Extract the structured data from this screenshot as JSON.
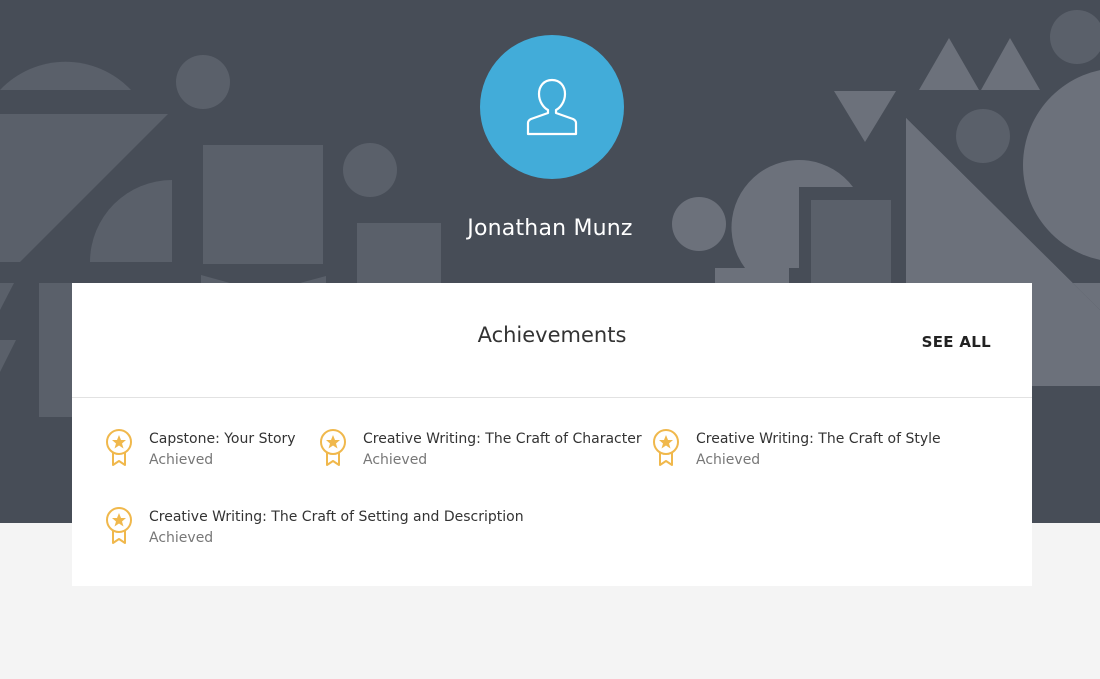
{
  "profile": {
    "name": "Jonathan Munz",
    "avatar_icon": "user-icon",
    "avatar_color": "#42acd9"
  },
  "achievements": {
    "title": "Achievements",
    "see_all_label": "SEE ALL",
    "badge_icon": "award-ribbon-icon",
    "badge_color": "#f0b84c",
    "items": [
      {
        "title": "Capstone: Your Story",
        "status": "Achieved"
      },
      {
        "title": "Creative Writing: The Craft of Character",
        "status": "Achieved"
      },
      {
        "title": "Creative Writing: The Craft of Style",
        "status": "Achieved"
      },
      {
        "title": "Creative Writing: The Craft of Setting and Description",
        "status": "Achieved"
      }
    ]
  },
  "colors": {
    "hero_background": "#474d57",
    "page_background": "#f4f4f4"
  }
}
